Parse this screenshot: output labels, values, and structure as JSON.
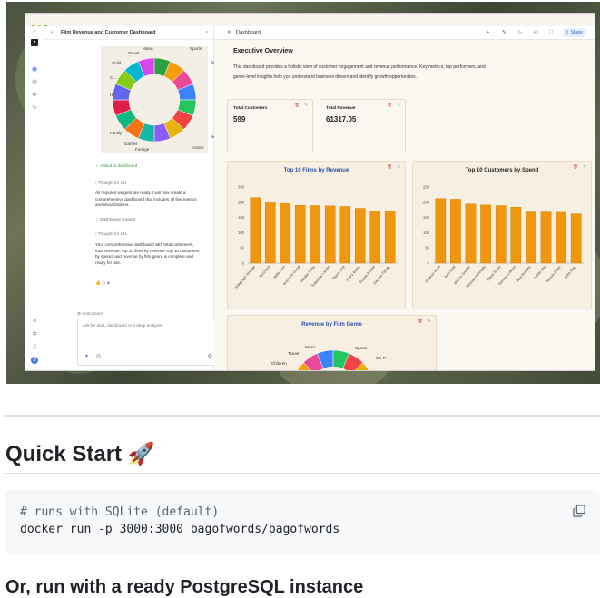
{
  "screenshot": {
    "chat": {
      "title": "Film Revenue and Customer Dashboard",
      "donut_labels": [
        "Music",
        "Sports",
        "Travel",
        "Sci-Fi",
        "Child...",
        "C...",
        "H",
        "Family",
        "Games",
        "Foreign",
        "New",
        "Action"
      ],
      "added_to_dashboard": "Added to dashboard",
      "thought1": "Thought for 11s",
      "message1": [
        "All required widgets are ready. I will now create a",
        "comprehensive dashboard that includes all five metrics",
        "and visualizations."
      ],
      "dashboard_created": "Dashboard created",
      "thought2": "Thought for 14s",
      "message2": [
        "Your comprehensive dashboard with total customers,",
        "total revenue, top 10 films by revenue, top 10 customers",
        "by spend, and revenue by film genre is complete and",
        "ready for use."
      ],
      "instructions": "Instructions",
      "input_placeholder": "Ask for data, dashboard or a deep analysis"
    },
    "dashboard": {
      "tab_label": "Dashboard",
      "share_label": "Share",
      "overview_title": "Executive Overview",
      "overview_text": [
        "This dashboard provides a holistic view of customer engagement and revenue performance. Key metrics, top performers, and",
        "genre-level insights help you understand business drivers and identify growth opportunities."
      ],
      "kpis": [
        {
          "label": "Total Customers",
          "value": "599"
        },
        {
          "label": "Total Revenue",
          "value": "61317.05"
        }
      ],
      "genre_title": "Revenue by Film Genre",
      "genre_labels": [
        "Music",
        "Sports",
        "Travel",
        "Sci-Fi",
        "Children"
      ]
    }
  },
  "chart_data": [
    {
      "type": "bar",
      "title": "Top 10 Films by Revenue",
      "categories": [
        "Telegraph Voyage",
        "Zorro Ark",
        "Wife Turn",
        "Innocent Usual",
        "Hustler Party",
        "Saturday Lambs",
        "Titans Jerk",
        "Harry Idaho",
        "Torque Bound",
        "Dogma Family"
      ],
      "values": [
        215,
        198,
        196,
        190,
        189,
        188,
        186,
        180,
        172,
        170
      ],
      "ylim": [
        0,
        250
      ],
      "yticks": [
        0,
        50,
        100,
        150,
        200,
        250
      ],
      "color": "#f0960f"
    },
    {
      "type": "bar",
      "title": "Top 10 Customers by Spend",
      "categories": [
        "Eleanor Hunt",
        "Karl Seal",
        "Marion Snyder",
        "Rhonda Kennedy",
        "Clara Shaw",
        "Tommy Collazo",
        "Ana Bradley",
        "Curtis Irby",
        "Marcia Dean",
        "Mike Way"
      ],
      "values": [
        212,
        210,
        194,
        191,
        189,
        184,
        168,
        168,
        167,
        162
      ],
      "ylim": [
        0,
        250
      ],
      "yticks": [
        0,
        50,
        100,
        150,
        200,
        250
      ],
      "color": "#f0960f"
    }
  ],
  "readme": {
    "quick_start": "Quick Start 🚀",
    "code_comment": "# runs with SQLite (default)",
    "code_command": "docker run -p 3000:3000 bagofwords/bagofwords",
    "postgres_heading": "Or, run with a ready PostgreSQL instance"
  }
}
